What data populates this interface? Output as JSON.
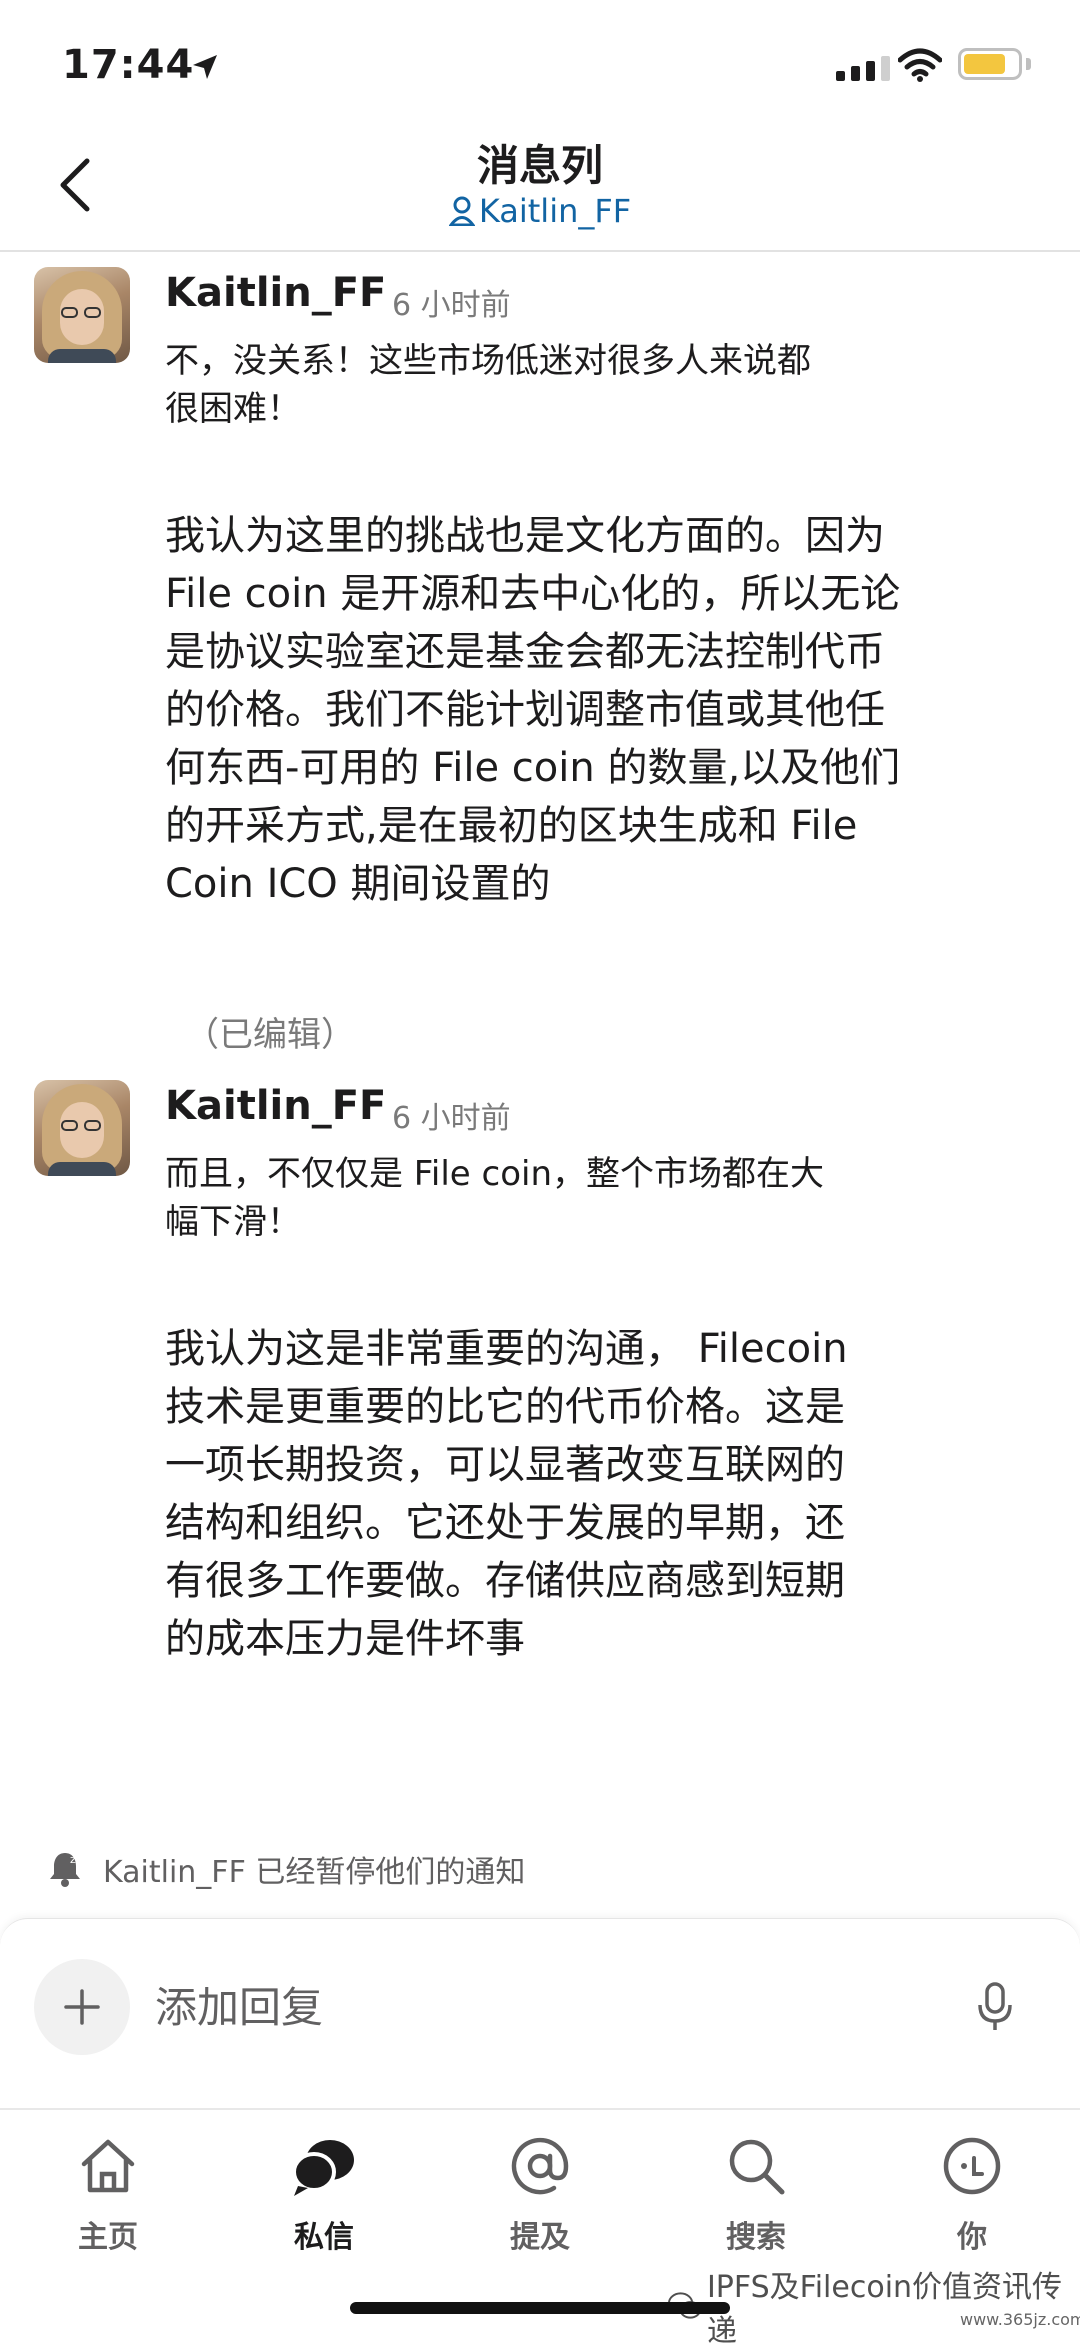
{
  "status_bar": {
    "time": "17:44"
  },
  "header": {
    "title": "消息列",
    "subtitle": "Kaitlin_FF"
  },
  "messages": [
    {
      "author": "Kaitlin_FF",
      "time_ago": "6 小时前",
      "lines_small": [
        "不，没关系！这些市场低迷对很多人来说都",
        "很困难！"
      ],
      "lines_large": [
        "我认为这里的挑战也是文化方面的。因为",
        "File coin 是开源和去中心化的，所以无论",
        "是协议实验室还是基金会都无法控制代币",
        "的价格。我们不能计划调整市值或其他任",
        "何东西-可用的 File coin 的数量,以及他们",
        "的开采方式,是在最初的区块生成和 File",
        "Coin ICO 期间设置的"
      ],
      "edited": "（已编辑）"
    },
    {
      "author": "Kaitlin_FF",
      "time_ago": "6 小时前",
      "lines_small": [
        "而且，不仅仅是 File coin，整个市场都在大",
        "幅下滑！"
      ],
      "lines_large": [
        "我认为这是非常重要的沟通， Filecoin",
        "技术是更重要的比它的代币价格。这是",
        "一项长期投资，可以显著改变互联网的",
        "结构和组织。它还处于发展的早期，还",
        "有很多工作要做。存储供应商感到短期",
        "的成本压力是件坏事"
      ]
    }
  ],
  "notice": "Kaitlin_FF 已经暂停他们的通知",
  "composer": {
    "placeholder": "添加回复"
  },
  "tabs": [
    {
      "label": "主页",
      "icon": "home-icon"
    },
    {
      "label": "私信",
      "icon": "direct-messages-icon",
      "active": true
    },
    {
      "label": "提及",
      "icon": "mention-icon"
    },
    {
      "label": "搜索",
      "icon": "search-icon"
    },
    {
      "label": "你",
      "icon": "profile-icon"
    }
  ],
  "watermark": "IPFS及Filecoin价值资讯传递",
  "site_watermark": "www.365jz.com",
  "colors": {
    "link": "#1264a3",
    "text": "#1d1c1d",
    "muted": "#7a7a7a",
    "battery": "#f3c63f"
  }
}
